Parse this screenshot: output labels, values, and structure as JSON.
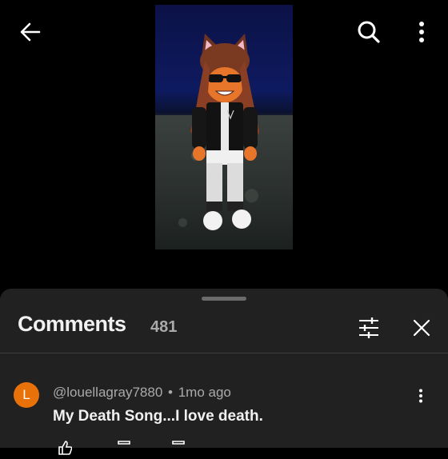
{
  "header": {
    "back_icon": "arrow-left-icon",
    "search_icon": "search-icon",
    "more_icon": "more-vertical-icon"
  },
  "video": {
    "description_icon": "roblox-avatar-thumbnail"
  },
  "comments": {
    "title": "Comments",
    "count": "481",
    "filter_icon": "sliders-icon",
    "close_icon": "close-icon",
    "items": [
      {
        "avatar_letter": "L",
        "avatar_color": "#e8710a",
        "author": "@louellagray7880",
        "separator": "•",
        "time": "1mo ago",
        "text": "My Death Song...I love death.",
        "menu_icon": "more-vertical-icon"
      }
    ]
  },
  "colors": {
    "background": "#000000",
    "sheet": "#212121",
    "text_primary": "#f1f1f1",
    "text_secondary": "#aaaaaa"
  }
}
